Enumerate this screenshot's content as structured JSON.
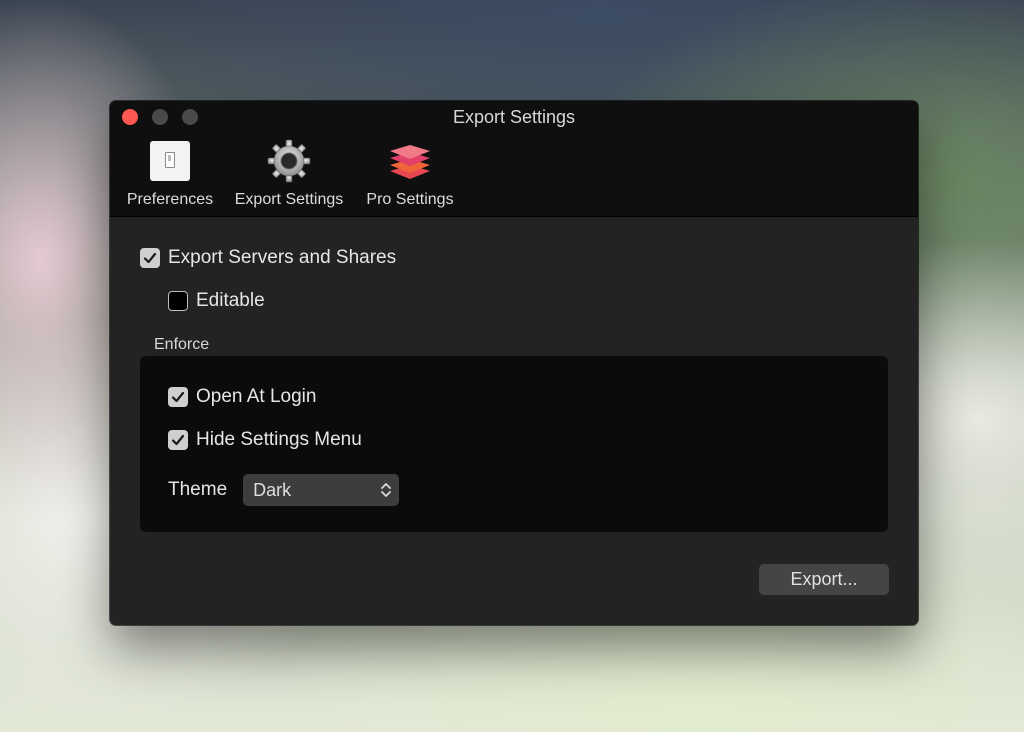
{
  "window": {
    "title": "Export Settings"
  },
  "toolbar": {
    "items": [
      {
        "label": "Preferences",
        "icon": "light-switch-icon"
      },
      {
        "label": "Export Settings",
        "icon": "gear-icon"
      },
      {
        "label": "Pro Settings",
        "icon": "layers-icon"
      }
    ]
  },
  "options": {
    "export_servers": {
      "label": "Export Servers and Shares",
      "checked": true
    },
    "editable": {
      "label": "Editable",
      "checked": false
    }
  },
  "enforce": {
    "label": "Enforce",
    "open_at_login": {
      "label": "Open At Login",
      "checked": true
    },
    "hide_settings_menu": {
      "label": "Hide Settings Menu",
      "checked": true
    },
    "theme": {
      "label": "Theme",
      "value": "Dark"
    }
  },
  "actions": {
    "export_label": "Export..."
  },
  "colors": {
    "close": "#fc5753",
    "window_bg": "#232323",
    "toolbar_bg": "#0f0f0f",
    "group_bg": "#0b0b0b"
  }
}
